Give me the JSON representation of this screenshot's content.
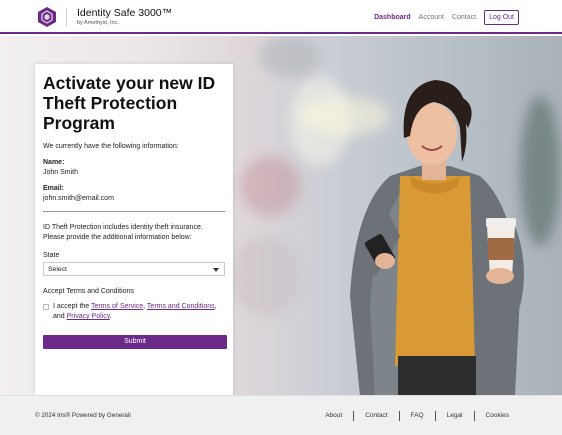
{
  "header": {
    "brand_title": "Identity Safe 3000™",
    "brand_subtitle": "by Amethyst, Inc.",
    "nav": [
      "Dashboard",
      "Account",
      "Contact"
    ],
    "logout_label": "Log Out",
    "accent_color": "#6b2a8a"
  },
  "form": {
    "title": "Activate your new ID Theft Protection Program",
    "intro": "We currently have the following information:",
    "name_label": "Name:",
    "name_value": "John Smith",
    "email_label": "Email:",
    "email_value": "john.smith@email.com",
    "info": "ID Theft Protection includes identity theft insurance. Please provide the additional information below:",
    "state_label": "State",
    "state_value": "Select",
    "terms_title": "Accept Terms and Conditions",
    "terms_prefix": "I accept the",
    "terms_link1": "Terms of Service",
    "terms_link2": "Terms and Conditions",
    "terms_and": "and",
    "terms_link3": "Privacy Policy",
    "submit_label": "Submit"
  },
  "footer": {
    "copyright": "© 2024 Iris® Powered by Generali",
    "links": [
      "About",
      "Contact",
      "FAQ",
      "Legal",
      "Cookies"
    ]
  },
  "icons": [
    "hexagon-shield-logo-icon",
    "chevron-down-icon"
  ]
}
